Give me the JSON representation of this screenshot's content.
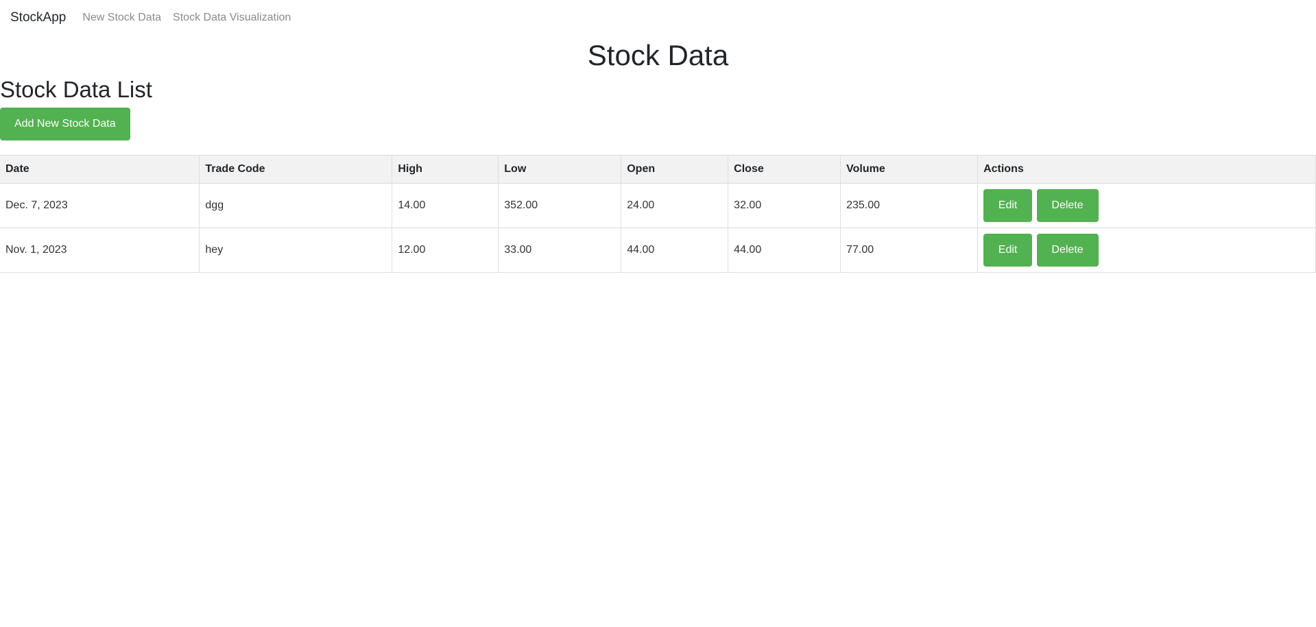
{
  "navbar": {
    "brand": "StockApp",
    "links": [
      "New Stock Data",
      "Stock Data Visualization"
    ]
  },
  "page_title": "Stock Data",
  "list_title": "Stock Data List",
  "add_button_label": "Add New Stock Data",
  "table": {
    "headers": [
      "Date",
      "Trade Code",
      "High",
      "Low",
      "Open",
      "Close",
      "Volume",
      "Actions"
    ],
    "rows": [
      {
        "date": "Dec. 7, 2023",
        "trade_code": "dgg",
        "high": "14.00",
        "low": "352.00",
        "open": "24.00",
        "close": "32.00",
        "volume": "235.00",
        "edit_label": "Edit",
        "delete_label": "Delete"
      },
      {
        "date": "Nov. 1, 2023",
        "trade_code": "hey",
        "high": "12.00",
        "low": "33.00",
        "open": "44.00",
        "close": "44.00",
        "volume": "77.00",
        "edit_label": "Edit",
        "delete_label": "Delete"
      }
    ]
  },
  "colors": {
    "accent_green": "#52b150",
    "header_bg": "#f2f2f2",
    "nav_link": "#8a8a8a"
  }
}
